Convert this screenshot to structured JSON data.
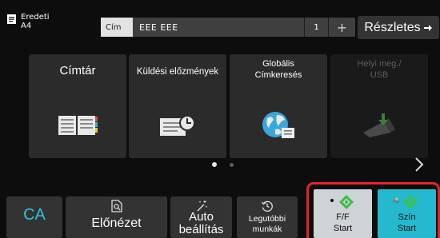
{
  "original": {
    "line1": "Eredeti",
    "line2": "A4",
    "icon": "document-icon"
  },
  "address_field": {
    "label": "Cím",
    "value": "EEE EEE",
    "count": "1",
    "plus": "+"
  },
  "details_button": {
    "label": "Részletes",
    "icon": "arrow-right-icon"
  },
  "tiles": [
    {
      "label": "Címtár",
      "icon": "address-book-icon"
    },
    {
      "label": "Küldési előzmények",
      "icon": "send-history-icon"
    },
    {
      "label_line1": "Globális",
      "label_line2": "Címkeresés",
      "icon": "globe-search-icon"
    },
    {
      "label_line1": "Helyi meg./",
      "label_line2": "USB",
      "icon": "usb-icon",
      "disabled": true
    }
  ],
  "pagination": {
    "pages": 2,
    "current": 1
  },
  "bottom": {
    "ca": "CA",
    "preview": "Előnézet",
    "auto_line1": "Auto",
    "auto_line2": "beállítás",
    "recent_line1": "Legutóbbi",
    "recent_line2": "munkák"
  },
  "start": {
    "bw_line1": "F/F",
    "bw_line2": "Start",
    "color_line1": "Szín",
    "color_line2": "Start"
  },
  "colors": {
    "accent_cyan": "#25b9d0",
    "ca_cyan": "#2ec4dc",
    "highlight_red": "#e8212b",
    "start_green": "#3cc04a"
  }
}
